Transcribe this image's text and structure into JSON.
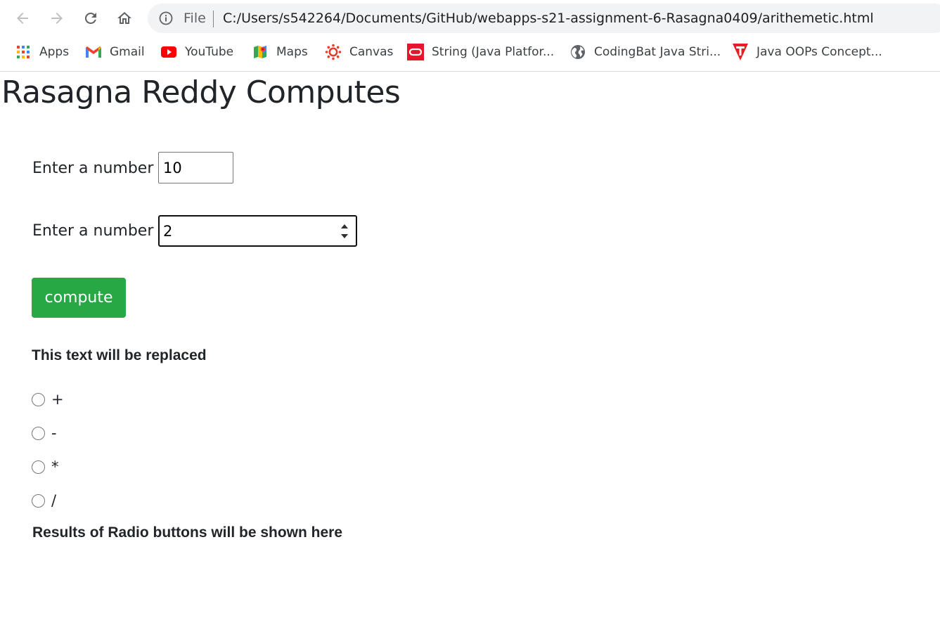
{
  "browser": {
    "scheme_label": "File",
    "url": "C:/Users/s542264/Documents/GitHub/webapps-s21-assignment-6-Rasagna0409/arithemetic.html"
  },
  "bookmarks": [
    {
      "label": "Apps",
      "icon": "apps-grid-icon"
    },
    {
      "label": "Gmail",
      "icon": "gmail-icon"
    },
    {
      "label": "YouTube",
      "icon": "youtube-icon"
    },
    {
      "label": "Maps",
      "icon": "maps-icon"
    },
    {
      "label": "Canvas",
      "icon": "canvas-icon"
    },
    {
      "label": "String (Java Platfor...",
      "icon": "oracle-icon"
    },
    {
      "label": "CodingBat Java Stri...",
      "icon": "globe-icon"
    },
    {
      "label": "Java OOPs Concept...",
      "icon": "javatpoint-icon"
    }
  ],
  "page": {
    "title": "Rasagna Reddy Computes",
    "fields": [
      {
        "label": "Enter a number",
        "value": "10"
      },
      {
        "label": "Enter a number",
        "value": "2"
      }
    ],
    "compute_label": "compute",
    "replace_text": "This text will be replaced",
    "operators": [
      "+",
      "-",
      "*",
      "/"
    ],
    "results_text": "Results of Radio buttons will be shown here"
  },
  "colors": {
    "compute_button": "#28a745",
    "omnibox_bg": "#f1f3f4"
  }
}
